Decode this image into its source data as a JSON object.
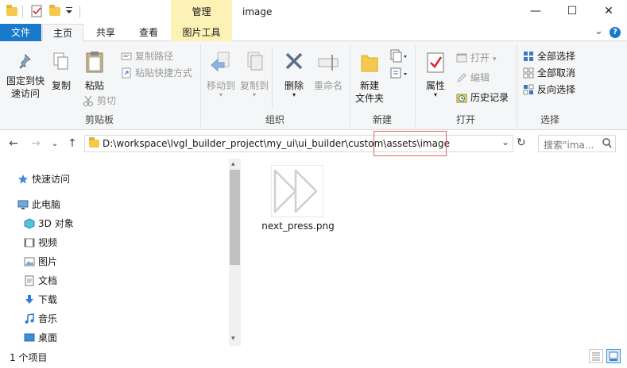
{
  "titlebar": {
    "manage_tab": "管理",
    "window_title": "image",
    "minimize": "—",
    "maximize": "☐",
    "close": "✕",
    "quick_access_down": "▾"
  },
  "ribbon_tabs": {
    "file": "文件",
    "home": "主页",
    "share": "共享",
    "view": "查看",
    "picture_tools": "图片工具",
    "expand": "⌄",
    "help": "?"
  },
  "ribbon": {
    "clipboard": {
      "pin": "固定到快\n速访问",
      "pin_line1": "固定到快",
      "pin_line2": "速访问",
      "copy": "复制",
      "paste": "粘贴",
      "copy_path": "复制路径",
      "paste_shortcut": "粘贴快捷方式",
      "cut": "剪切",
      "label": "剪贴板"
    },
    "organize": {
      "move_to": "移动到",
      "copy_to": "复制到",
      "delete": "删除",
      "rename": "重命名",
      "label": "组织"
    },
    "new": {
      "new_folder_line1": "新建",
      "new_folder_line2": "文件夹",
      "label": "新建"
    },
    "open": {
      "properties": "属性",
      "open": "打开",
      "edit": "编辑",
      "history": "历史记录",
      "label": "打开"
    },
    "select": {
      "select_all": "全部选择",
      "select_none": "全部取消",
      "invert": "反向选择",
      "label": "选择"
    }
  },
  "address": {
    "path": "D:\\workspace\\lvgl_builder_project\\my_ui\\ui_builder\\custom\\assets\\image",
    "search_placeholder": "搜索\"ima...",
    "back": "←",
    "forward": "→",
    "recent": "⌄",
    "up": "↑",
    "dropdown": "⌄",
    "refresh": "↻"
  },
  "nav": {
    "items": [
      {
        "label": "快速访问"
      },
      {
        "label": "此电脑"
      },
      {
        "label": "3D 对象"
      },
      {
        "label": "视频"
      },
      {
        "label": "图片"
      },
      {
        "label": "文档"
      },
      {
        "label": "下载"
      },
      {
        "label": "音乐"
      },
      {
        "label": "桌面"
      }
    ]
  },
  "content": {
    "files": [
      {
        "name": "next_press.png"
      }
    ]
  },
  "status": {
    "count": "1 个项目"
  },
  "colors": {
    "accent": "#1979ca",
    "picture_tools_tab": "#fdf2b5",
    "highlight": "#e06464"
  }
}
